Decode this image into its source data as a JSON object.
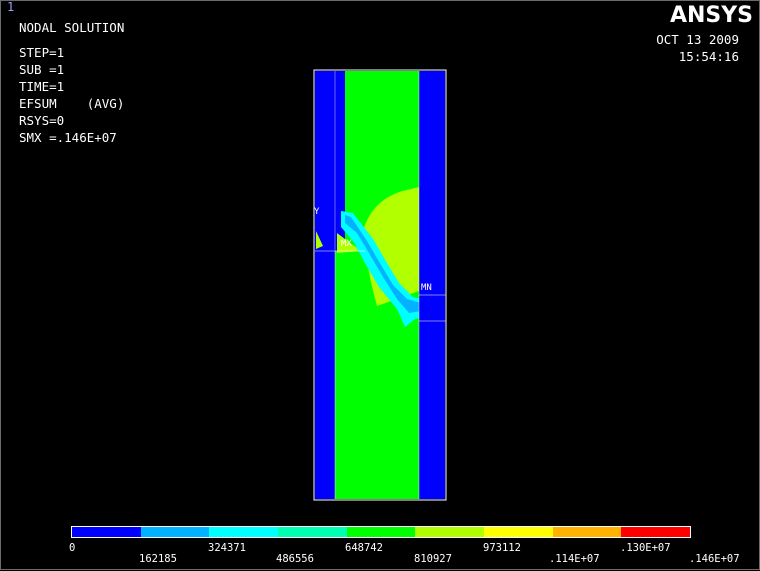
{
  "window_number": "1",
  "info": {
    "title": "NODAL SOLUTION",
    "lines": [
      "STEP=1",
      "SUB =1",
      "TIME=1",
      "EFSUM    (AVG)",
      "RSYS=0",
      "SMX =.146E+07"
    ]
  },
  "logo": "ANSYS",
  "date": "OCT 13 2009",
  "time": "15:54:16",
  "labels": {
    "axis_y": "Y",
    "mx": "MX",
    "mn": "MN"
  },
  "colors": {
    "blue": "#0000ff",
    "light_blue": "#00b2ff",
    "cyan": "#00ffff",
    "aqua_green": "#00ffb2",
    "green": "#00ff00",
    "yellow_green": "#b2ff00",
    "yellow": "#ffff00",
    "orange": "#ffb200",
    "red": "#ff0000"
  },
  "legend": {
    "bands": [
      "#0000ff",
      "#00b2ff",
      "#00ffff",
      "#00ffb2",
      "#00ff00",
      "#b2ff00",
      "#ffff00",
      "#ffb200",
      "#ff0000"
    ],
    "values": [
      "0",
      "162185",
      "324371",
      "486556",
      "648742",
      "810927",
      "973112",
      ".114E+07",
      ".130E+07",
      ".146E+07"
    ]
  }
}
